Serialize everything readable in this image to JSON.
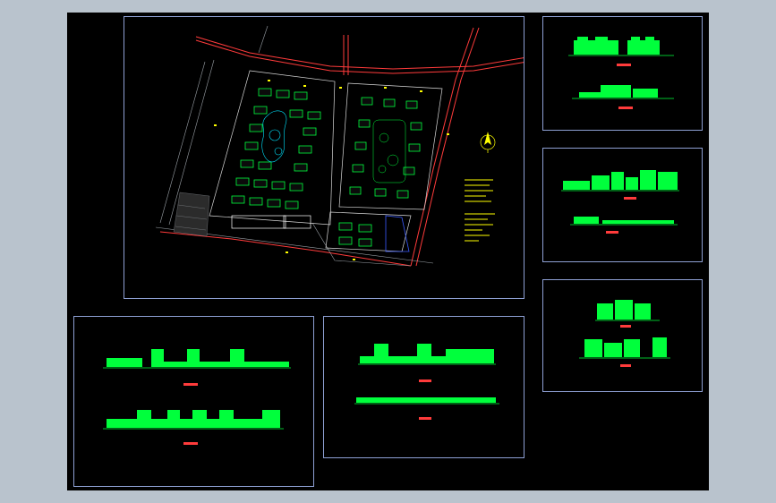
{
  "colors": {
    "background": "#b9c3cd",
    "canvas": "#000000",
    "frame": "#8ea0d4",
    "building": "#00ff3c",
    "road_red": "#ff3b3b",
    "annotation": "#ffff00",
    "cyan": "#00e5ff",
    "grey_line": "#9aa0a6",
    "blue": "#3a5bff"
  },
  "icons": {
    "north_arrow": "north-arrow-icon"
  },
  "viewports": [
    {
      "id": "site-plan",
      "type": "site-plan"
    },
    {
      "id": "elev-top-right",
      "type": "elevations",
      "count": 2
    },
    {
      "id": "elev-mid-right",
      "type": "elevations",
      "count": 2
    },
    {
      "id": "elev-bottom-right",
      "type": "elevations",
      "count": 2
    },
    {
      "id": "elev-bottom-left",
      "type": "elevations",
      "count": 2
    },
    {
      "id": "elev-bottom-center",
      "type": "elevations",
      "count": 2
    }
  ]
}
